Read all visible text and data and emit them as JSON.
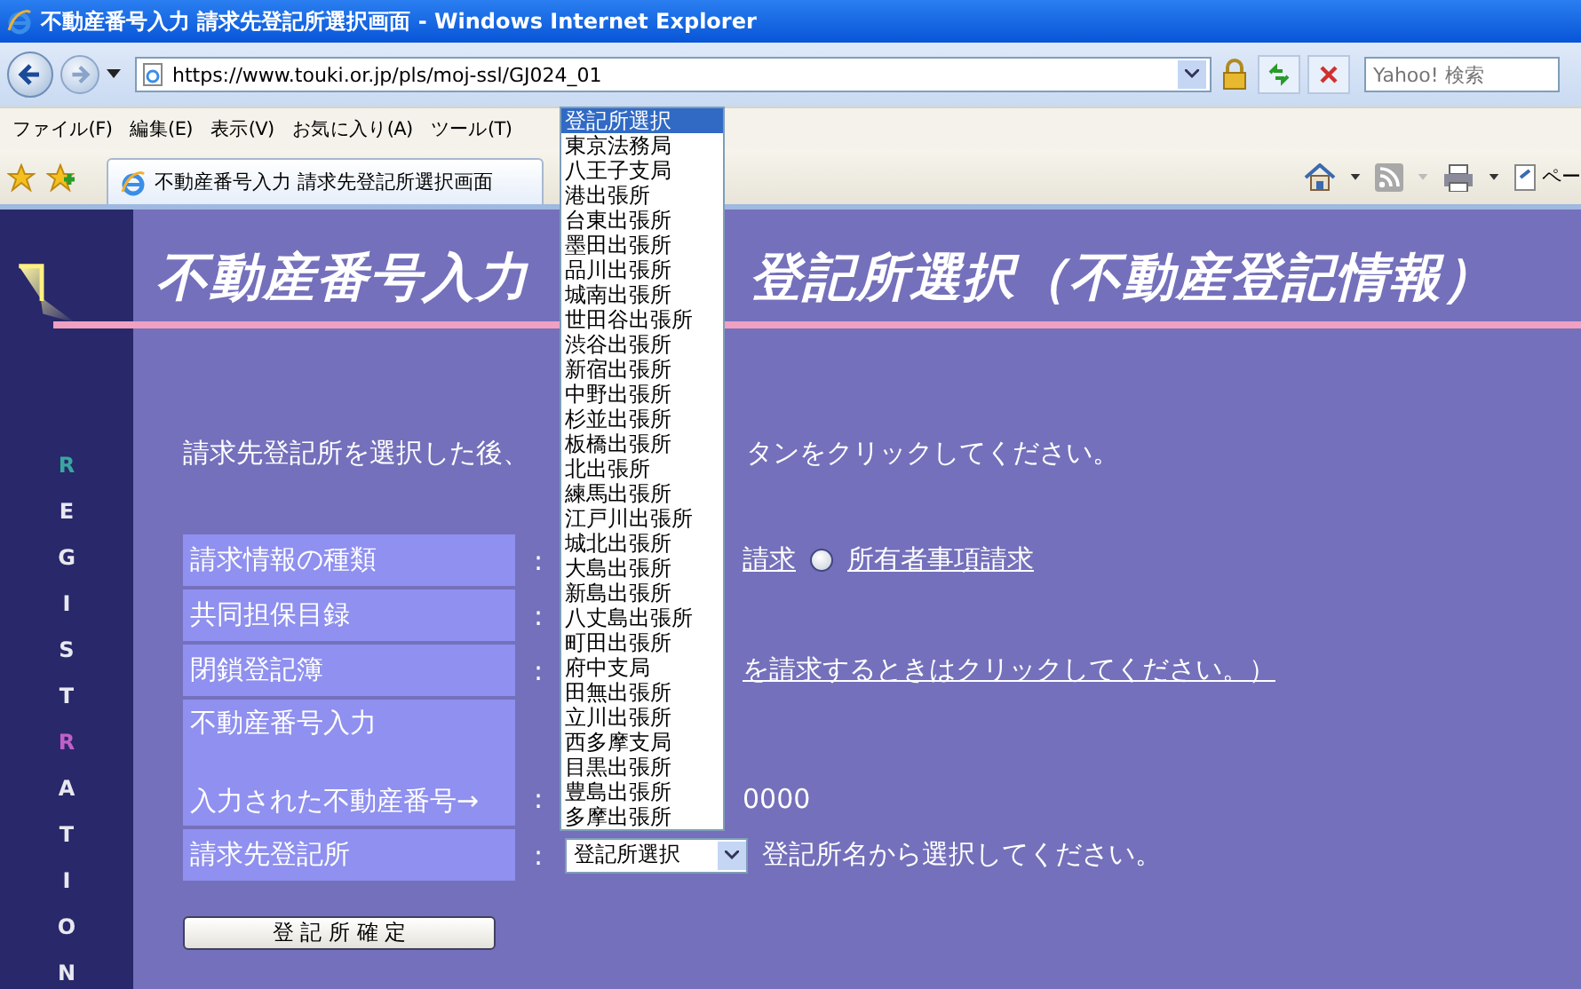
{
  "window": {
    "title": "不動産番号入力 請求先登記所選択画面 - Windows Internet Explorer"
  },
  "address_bar": {
    "url": "https://www.touki.or.jp/pls/moj-ssl/GJ024_01",
    "search_placeholder": "Yahoo! 検索"
  },
  "menu": [
    "ファイル(F)",
    "編集(E)",
    "表示(V)",
    "お気に入り(A)",
    "ツール(T)"
  ],
  "tab": {
    "title": "不動産番号入力 請求先登記所選択画面",
    "page_menu": "ペー"
  },
  "sidebar": {
    "letters": [
      {
        "letter": "R",
        "color": "#3aa6a0"
      },
      {
        "letter": "E",
        "color": "#e8e8f0"
      },
      {
        "letter": "G",
        "color": "#e8e8f0"
      },
      {
        "letter": "I",
        "color": "#e8e8f0"
      },
      {
        "letter": "S",
        "color": "#e8e8f0"
      },
      {
        "letter": "T",
        "color": "#e8e8f0"
      },
      {
        "letter": "R",
        "color": "#c060c8"
      },
      {
        "letter": "A",
        "color": "#e8e8f0"
      },
      {
        "letter": "T",
        "color": "#e8e8f0"
      },
      {
        "letter": "I",
        "color": "#e8e8f0"
      },
      {
        "letter": "O",
        "color": "#e8e8f0"
      },
      {
        "letter": "N",
        "color": "#e8e8f0"
      }
    ]
  },
  "heading": [
    "不動産番号入力",
    "登記所選択（不動産登記情報）"
  ],
  "instruction": [
    "請求先登記所を選択した後、",
    "タンをクリックしてください。"
  ],
  "form_rows": [
    {
      "label": [
        "請求情報の種類"
      ],
      "colon": ":",
      "values": [
        {
          "kind": "link",
          "text": "請求"
        },
        {
          "kind": "radio",
          "selected": false,
          "text": "所有者事項請求"
        }
      ]
    },
    {
      "label": [
        "共同担保目録"
      ],
      "colon": ":",
      "values": []
    },
    {
      "label": [
        "閉鎖登記簿"
      ],
      "colon": ":",
      "values": [
        {
          "kind": "link",
          "text": "を請求するときはクリックしてください。）"
        }
      ]
    },
    {
      "label": [
        "不動産番号入力",
        "入力された不動産番号→"
      ],
      "colon": ":",
      "values": [
        {
          "kind": "text",
          "text": "0000"
        }
      ]
    },
    {
      "label": [
        "請求先登記所"
      ],
      "colon": ":",
      "values": [
        {
          "kind": "select",
          "text": "登記所選択"
        },
        {
          "kind": "text",
          "text": "登記所名から選択してください。"
        }
      ]
    }
  ],
  "submit_button": "登 記 所 確 定",
  "dropdown_options": [
    {
      "text": "登記所選択",
      "selected": true
    },
    {
      "text": "東京法務局",
      "selected": false
    },
    {
      "text": "八王子支局",
      "selected": false
    },
    {
      "text": "港出張所",
      "selected": false
    },
    {
      "text": "台東出張所",
      "selected": false
    },
    {
      "text": "墨田出張所",
      "selected": false
    },
    {
      "text": "品川出張所",
      "selected": false
    },
    {
      "text": "城南出張所",
      "selected": false
    },
    {
      "text": "世田谷出張所",
      "selected": false
    },
    {
      "text": "渋谷出張所",
      "selected": false
    },
    {
      "text": "新宿出張所",
      "selected": false
    },
    {
      "text": "中野出張所",
      "selected": false
    },
    {
      "text": "杉並出張所",
      "selected": false
    },
    {
      "text": "板橋出張所",
      "selected": false
    },
    {
      "text": "北出張所",
      "selected": false
    },
    {
      "text": "練馬出張所",
      "selected": false
    },
    {
      "text": "江戸川出張所",
      "selected": false
    },
    {
      "text": "城北出張所",
      "selected": false
    },
    {
      "text": "大島出張所",
      "selected": false
    },
    {
      "text": "新島出張所",
      "selected": false
    },
    {
      "text": "八丈島出張所",
      "selected": false
    },
    {
      "text": "町田出張所",
      "selected": false
    },
    {
      "text": "府中支局",
      "selected": false
    },
    {
      "text": "田無出張所",
      "selected": false
    },
    {
      "text": "立川出張所",
      "selected": false
    },
    {
      "text": "西多摩支局",
      "selected": false
    },
    {
      "text": "目黒出張所",
      "selected": false
    },
    {
      "text": "豊島出張所",
      "selected": false
    },
    {
      "text": "多摩出張所",
      "selected": false
    }
  ]
}
